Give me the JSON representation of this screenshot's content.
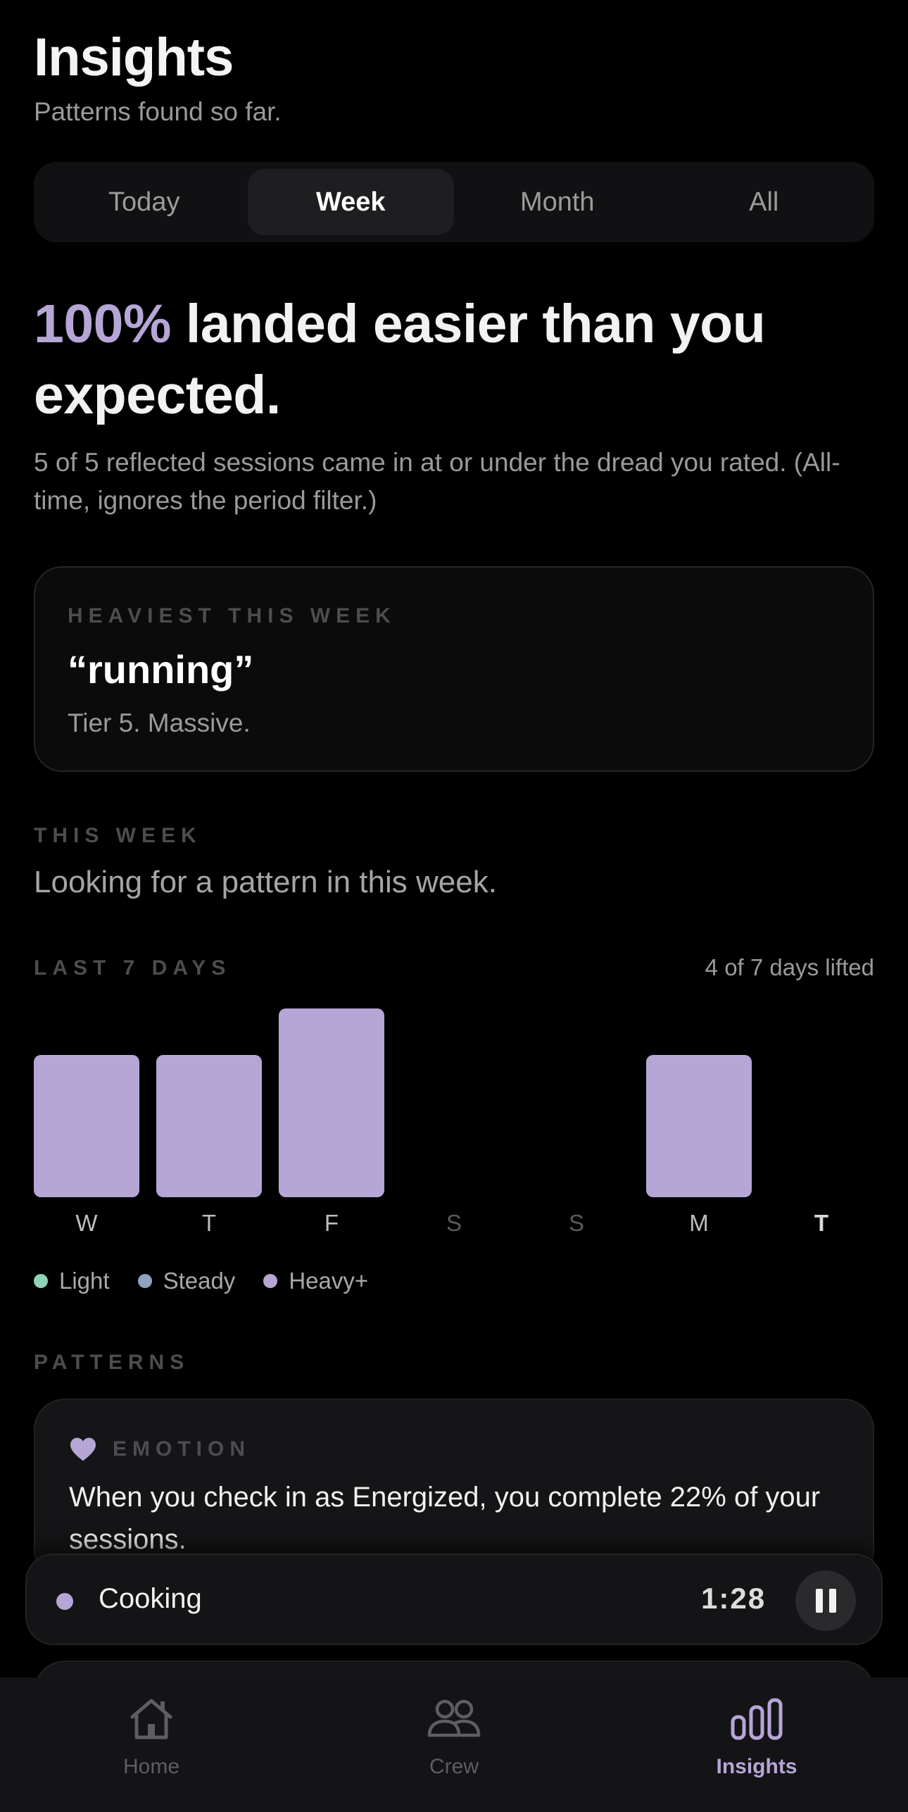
{
  "header": {
    "title": "Insights",
    "subtitle": "Patterns found so far."
  },
  "segments": {
    "items": [
      "Today",
      "Week",
      "Month",
      "All"
    ],
    "selected": "Week"
  },
  "headline": {
    "percent": "100%",
    "text": " landed easier than you expected.",
    "sub": "5 of 5 reflected sessions came in at or under the dread you rated. (All-time, ignores the period filter.)"
  },
  "heaviest": {
    "eyebrow": "HEAVIEST THIS WEEK",
    "word": "“running”",
    "tier": "Tier 5. Massive."
  },
  "this_week": {
    "eyebrow": "THIS WEEK",
    "text": "Looking for a pattern in this week."
  },
  "last7": {
    "eyebrow": "LAST 7 DAYS",
    "count": "4 of 7 days lifted"
  },
  "chart_data": {
    "type": "bar",
    "categories": [
      "W",
      "T",
      "F",
      "S",
      "S",
      "M",
      "T"
    ],
    "values": [
      2,
      2,
      2.65,
      0,
      0,
      2,
      0
    ],
    "ylim": [
      0,
      2.65
    ],
    "legend": [
      {
        "name": "Light",
        "color": "#8fd3b6"
      },
      {
        "name": "Steady",
        "color": "#8fa3bf"
      },
      {
        "name": "Heavy+",
        "color": "#b6a6d6"
      }
    ],
    "bar_color": "#b6a6d6"
  },
  "patterns": {
    "eyebrow": "PATTERNS",
    "card": {
      "icon": "heart-icon",
      "category": "EMOTION",
      "text": "When you check in as Energized, you complete 22% of your sessions."
    }
  },
  "timer": {
    "label": "Cooking",
    "time": "1:28",
    "icon": "pause-icon"
  },
  "tabbar": {
    "items": [
      {
        "label": "Home",
        "icon": "home-icon"
      },
      {
        "label": "Crew",
        "icon": "crew-icon"
      },
      {
        "label": "Insights",
        "icon": "insights-icon"
      }
    ],
    "active": "Insights"
  },
  "colors": {
    "accent": "#b6a6d6",
    "background": "#000000",
    "card": "#151517"
  }
}
